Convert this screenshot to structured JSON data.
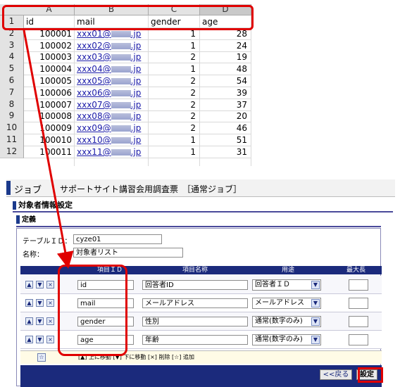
{
  "sheet": {
    "columns": [
      "A",
      "B",
      "C",
      "D"
    ],
    "header_row": {
      "row": "1",
      "id": "id",
      "mail": "mail",
      "gender": "gender",
      "age": "age"
    },
    "rows": [
      {
        "row": "2",
        "id": "100001",
        "mail_prefix": "xxx01@",
        "mail_suffix": ".jp",
        "gender": "1",
        "age": "28"
      },
      {
        "row": "3",
        "id": "100002",
        "mail_prefix": "xxx02@",
        "mail_suffix": ".jp",
        "gender": "1",
        "age": "24"
      },
      {
        "row": "4",
        "id": "100003",
        "mail_prefix": "xxx03@",
        "mail_suffix": ".jp",
        "gender": "2",
        "age": "19"
      },
      {
        "row": "5",
        "id": "100004",
        "mail_prefix": "xxx04@",
        "mail_suffix": ".jp",
        "gender": "1",
        "age": "48"
      },
      {
        "row": "6",
        "id": "100005",
        "mail_prefix": "xxx05@",
        "mail_suffix": ".jp",
        "gender": "2",
        "age": "54"
      },
      {
        "row": "7",
        "id": "100006",
        "mail_prefix": "xxx06@",
        "mail_suffix": ".jp",
        "gender": "2",
        "age": "39"
      },
      {
        "row": "8",
        "id": "100007",
        "mail_prefix": "xxx07@",
        "mail_suffix": ".jp",
        "gender": "2",
        "age": "37"
      },
      {
        "row": "9",
        "id": "100008",
        "mail_prefix": "xxx08@",
        "mail_suffix": ".jp",
        "gender": "2",
        "age": "20"
      },
      {
        "row": "10",
        "id": "100009",
        "mail_prefix": "xxx09@",
        "mail_suffix": ".jp",
        "gender": "2",
        "age": "46"
      },
      {
        "row": "11",
        "id": "100010",
        "mail_prefix": "xxx10@",
        "mail_suffix": ".jp",
        "gender": "1",
        "age": "51"
      },
      {
        "row": "12",
        "id": "100011",
        "mail_prefix": "xxx11@",
        "mail_suffix": ".jp",
        "gender": "1",
        "age": "31"
      }
    ]
  },
  "job": {
    "prefix": "ジョブ",
    "title": "サポートサイト講習会用調査票　［通常ジョブ］",
    "target_section": "対象者情報設定",
    "definition_section": "定義",
    "table_id_label": "テーブルＩＤ：",
    "table_id_value": "cyze01",
    "name_label": "名称：",
    "name_value": "対象者リスト",
    "headers": {
      "item_id": "項目ＩＤ",
      "item_name": "項目名称",
      "usage": "用途",
      "max_length": "最大長"
    },
    "rows": [
      {
        "item_id": "id",
        "item_name": "回答者ID",
        "usage": "回答者ＩＤ"
      },
      {
        "item_id": "mail",
        "item_name": "メールアドレス",
        "usage": "メールアドレス"
      },
      {
        "item_id": "gender",
        "item_name": "性別",
        "usage": "通常(数字のみ)"
      },
      {
        "item_id": "age",
        "item_name": "年齢",
        "usage": "通常(数字のみ)"
      }
    ],
    "add_button": "☆",
    "legend": "[▲] 上に移動 [▼] 下に移動 [×] 削除 [☆] 追加",
    "back_button": "<<戻る",
    "set_button": "設定"
  },
  "colors": {
    "highlight": "#e00000",
    "navy": "#1b2a7c",
    "link": "#1a1aa8"
  }
}
